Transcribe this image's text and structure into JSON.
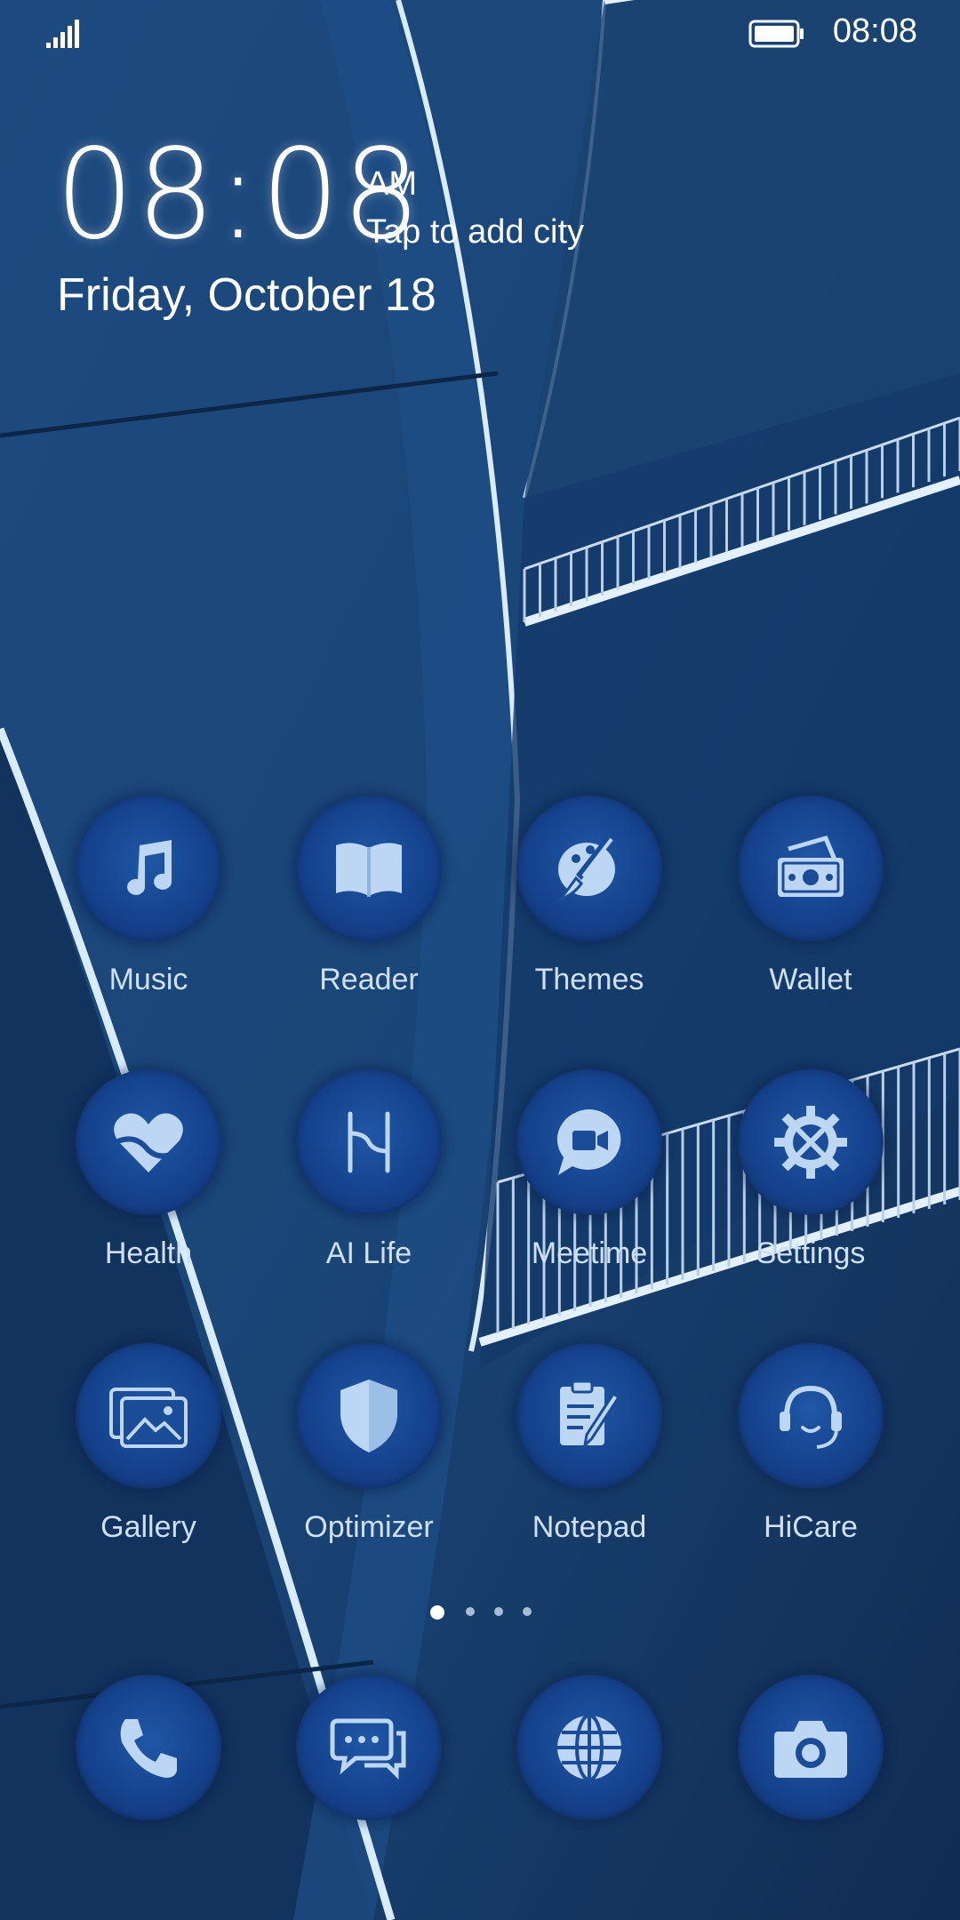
{
  "status_bar": {
    "time": "08:08",
    "signal_icon": "signal-icon",
    "battery_icon": "battery-icon"
  },
  "lock_widget": {
    "clock": "08:08",
    "ampm": "AM",
    "city_prompt": "Tap to add city",
    "date": "Friday, October 18"
  },
  "apps": [
    {
      "label": "Music",
      "icon": "music-note-icon"
    },
    {
      "label": "Reader",
      "icon": "book-icon"
    },
    {
      "label": "Themes",
      "icon": "paint-brush-icon"
    },
    {
      "label": "Wallet",
      "icon": "wallet-icon"
    },
    {
      "label": "Health",
      "icon": "heart-icon"
    },
    {
      "label": "AI Life",
      "icon": "ai-life-icon"
    },
    {
      "label": "Meetime",
      "icon": "video-chat-icon"
    },
    {
      "label": "Settings",
      "icon": "gear-icon"
    },
    {
      "label": "Gallery",
      "icon": "gallery-icon"
    },
    {
      "label": "Optimizer",
      "icon": "shield-icon"
    },
    {
      "label": "Notepad",
      "icon": "notepad-icon"
    },
    {
      "label": "HiCare",
      "icon": "headset-icon"
    }
  ],
  "dock": [
    {
      "icon": "phone-icon"
    },
    {
      "icon": "messages-icon"
    },
    {
      "icon": "globe-icon"
    },
    {
      "icon": "camera-icon"
    }
  ],
  "page_indicator": {
    "pages": 4,
    "current": 1
  },
  "colors": {
    "icon_glyph": "#bcd6f4",
    "wallpaper_base": "#173d6e",
    "icon_bg": "#1a4c97"
  }
}
